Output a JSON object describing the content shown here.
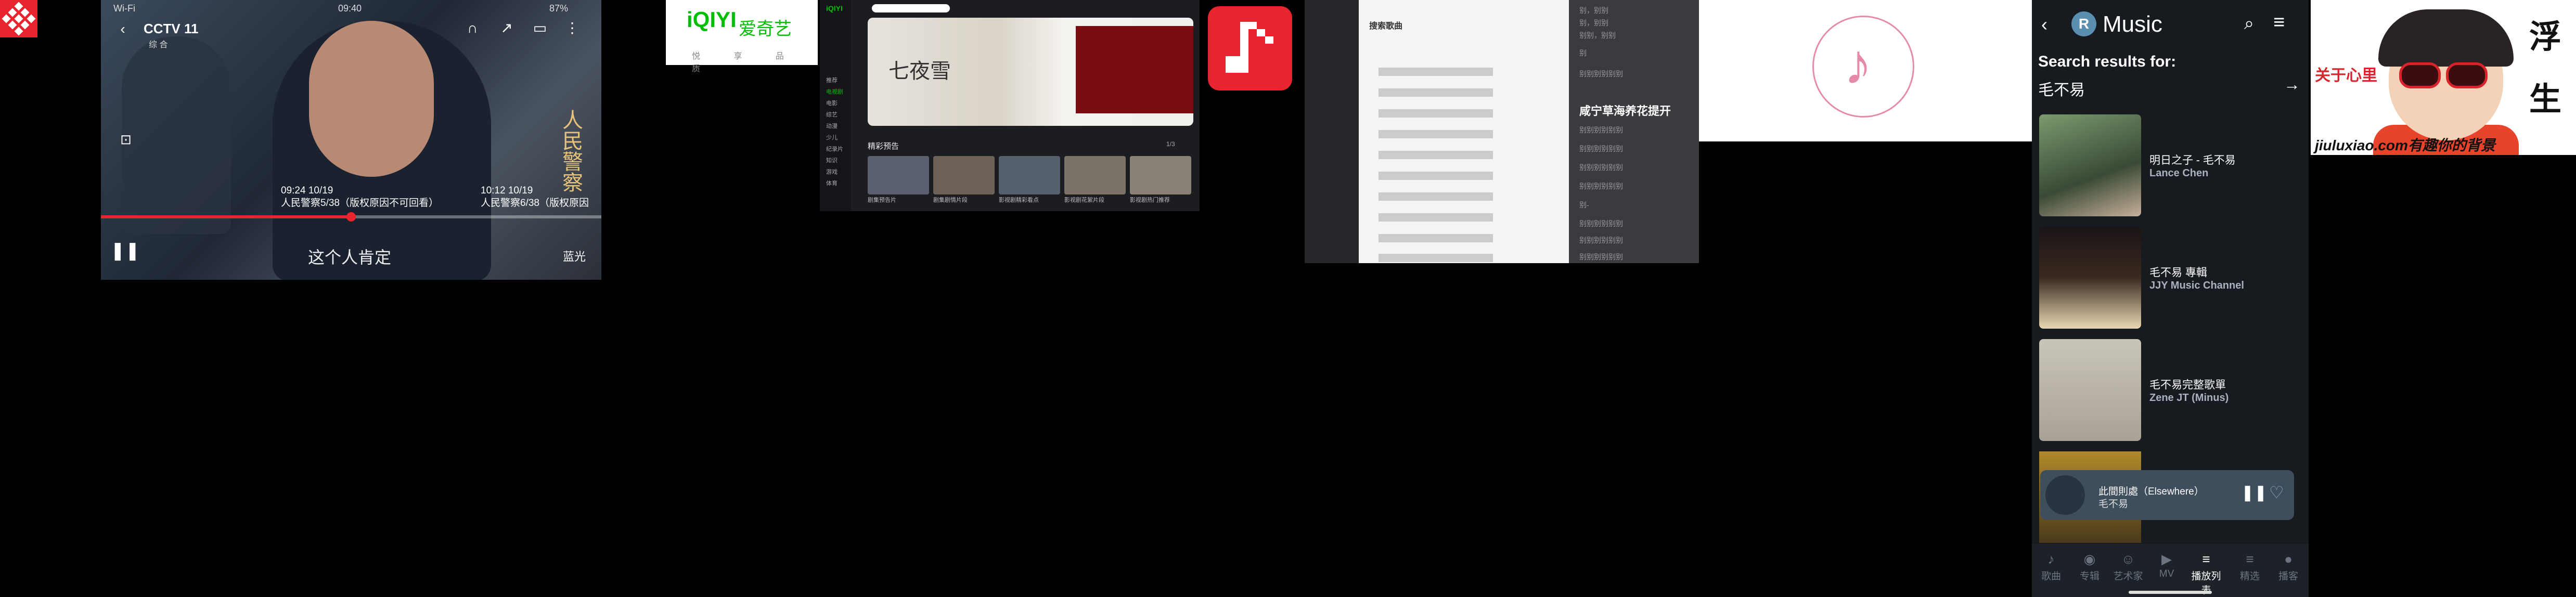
{
  "video": {
    "wifi": "Wi-Fi",
    "time": "09:40",
    "battery": "87%",
    "channel": "CCTV 11",
    "channel_sub": "综 合",
    "tip_left_time": "09:24 10/19",
    "tip_left_title": "人民警察5/38（版权原因不可回看）",
    "tip_right_time": "10:12 10/19",
    "tip_right_title": "人民警察6/38（版权原因",
    "subtitle": "这个人肯定",
    "bluray": "蓝光",
    "progress_fraction": 0.5,
    "watermark": "人民警察"
  },
  "iqiyi": {
    "logo": "iQIYI",
    "name": "爱奇艺",
    "slogan": "悦 享 品 质"
  },
  "iqiyi_desktop": {
    "logo": "iQIYI",
    "sidebar": [
      "推荐",
      "电视剧",
      "电影",
      "综艺",
      "动漫",
      "少儿",
      "纪录片",
      "知识",
      "游戏",
      "体育"
    ],
    "section": "精彩预告",
    "pager": "1/3",
    "banner_title": "七夜雪",
    "captions": [
      "剧集预告片",
      "剧集剧情片段",
      "影视剧精彩看点",
      "影视剧花絮片段",
      "影视剧热门推荐"
    ]
  },
  "desktop_list": {
    "header": "搜索歌曲",
    "highlight": "咸宁草海养花提开",
    "right_lines": [
      "别，别别",
      "别，别别",
      "别别，别别",
      "别",
      "别别别别别别",
      "别别别别别别",
      "别别别别别别",
      "别别别别别别",
      "别别别别别别",
      "别-",
      "别别别别别别",
      "别别别别别别",
      "别别别别别别"
    ]
  },
  "phone": {
    "app_logo": "R",
    "app_title": "Music",
    "search_label": "Search results for:",
    "search_query": "毛不易",
    "results": [
      {
        "title": "明日之子 - 毛不易",
        "subtitle": "Lance Chen"
      },
      {
        "title": "毛不易 專輯",
        "subtitle": "JJY Music Channel"
      },
      {
        "title": "毛不易完整歌單",
        "subtitle": "Zene JT (Minus)"
      }
    ],
    "now_playing": {
      "title": "此間則處（Elsewhere）",
      "artist": "毛不易"
    },
    "tabs": [
      {
        "icon": "♪",
        "label": "歌曲"
      },
      {
        "icon": "◉",
        "label": "专辑"
      },
      {
        "icon": "☺",
        "label": "艺术家"
      },
      {
        "icon": "▶",
        "label": "MV"
      },
      {
        "icon": "≡",
        "label": "播放列表"
      },
      {
        "icon": "≡",
        "label": "精选"
      },
      {
        "icon": "●",
        "label": "播客"
      }
    ],
    "active_tab_index": 4
  },
  "cartoon": {
    "big1": "浮",
    "big2": "生",
    "side": "关于心里",
    "footer": "jiuluxiao.com有趣你的背景"
  },
  "colors": {
    "brand_red": "#e8252f",
    "iqiyi_green": "#00be06",
    "pink": "#e58ba8",
    "phone_bg": "#171b1f"
  }
}
